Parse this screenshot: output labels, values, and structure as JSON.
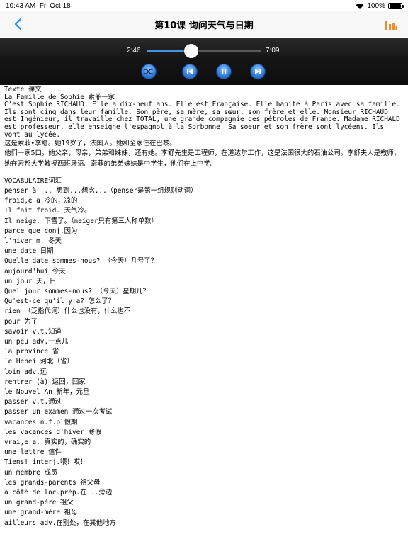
{
  "status_bar": {
    "time": "10:43 AM",
    "date": "Fri Oct 18",
    "battery": "100%",
    "battery_level": 1.0
  },
  "header": {
    "title": "第10课 询问天气与日期"
  },
  "player": {
    "current_time": "2:46",
    "total_time": "7:09",
    "progress": 0.39
  },
  "lesson": {
    "text_heading": "Texte 课文",
    "french_lines": [
      "La Famille de Sophie 索菲一家",
      "C'est Sophie RICHAUD. Elle a dix-neuf ans. Elle est Française. Elle habite à Paris avec sa famille.",
      "Ils sont cinq dans leur famille. Son père, sa mère, sa sœur, son frère et elle. Monsieur RICHAUD est Ingénieur, il travaille chez TOTAL, une grande compagnie des pétroles de France. Madame RICHALD est professeur, elle enseigne l'espagnol à la Sorbonne. Sa soeur et son frère sont lycéens. Ils vont au lycée."
    ],
    "chinese_lines": [
      "这是索菲•李舒。她19岁了，法国人。她和全家住在巴黎。",
      "他们一家5口。她父亲，母亲，弟弟和妹妹，还有她。李舒先生是工程师，在道达尔工作，这是法国很大的石油公司。李舒夫人是教师，她在索邦大学教授西班牙语。索菲的弟弟妹妹是中学生，他们在上中学。"
    ],
    "vocab_heading": "VOCABULAIRE词汇",
    "vocab": [
      "penser à ... 想到...想念...（penser是第一组规则动词）",
      "froid,e a.冷的，凉的",
      "Il fait froid. 天气冷。",
      "Il neige. 下雪了。（neiger只有第三人称单数）",
      "parce que conj.因为",
      "l'hiver m. 冬天",
      "une date 日期",
      "Quelle date sommes-nous? （今天）几号了？",
      "aujourd'hui 今天",
      "un jour 天，日",
      "Quel jour sommes-nous? （今天）星期几？",
      "Qu'est-ce qu'il y a? 怎么了？",
      "rien （泛指代词）什么也没有，什么也不",
      "pour 为了",
      "savoir v.t.知道",
      "un peu adv.一点儿",
      "la province 省",
      "le Hebei 河北（省）",
      "loin adv.远",
      "rentrer (à) 返回，回家",
      "le Nouvel An 新年，元旦",
      "passer v.t.通过",
      "passer un examen 通过一次考试",
      "vacances n.f.pl假期",
      "les vacances d'hiver 寒假",
      "vrai,e a. 真实的，确实的",
      "une lettre 信件",
      "Tiens! interj.喂！哎！",
      "un membre 成员",
      "les grands-parents 祖父母",
      "à côté de loc.prép.在...旁边",
      "un grand-père 祖父",
      "une grand-mère 祖母",
      "ailleurs adv.在别处，在其他地方"
    ]
  },
  "icons": {
    "back": "chevron-left-icon",
    "chart": "bar-chart-icon",
    "shuffle": "shuffle-icon",
    "previous": "skip-previous-icon",
    "pause": "pause-icon",
    "next": "skip-next-icon"
  },
  "colors": {
    "accent_blue": "#2f78d6",
    "back_blue": "#1a8cff",
    "chart_orange": "#f28c28",
    "player_bg": "#151515"
  }
}
